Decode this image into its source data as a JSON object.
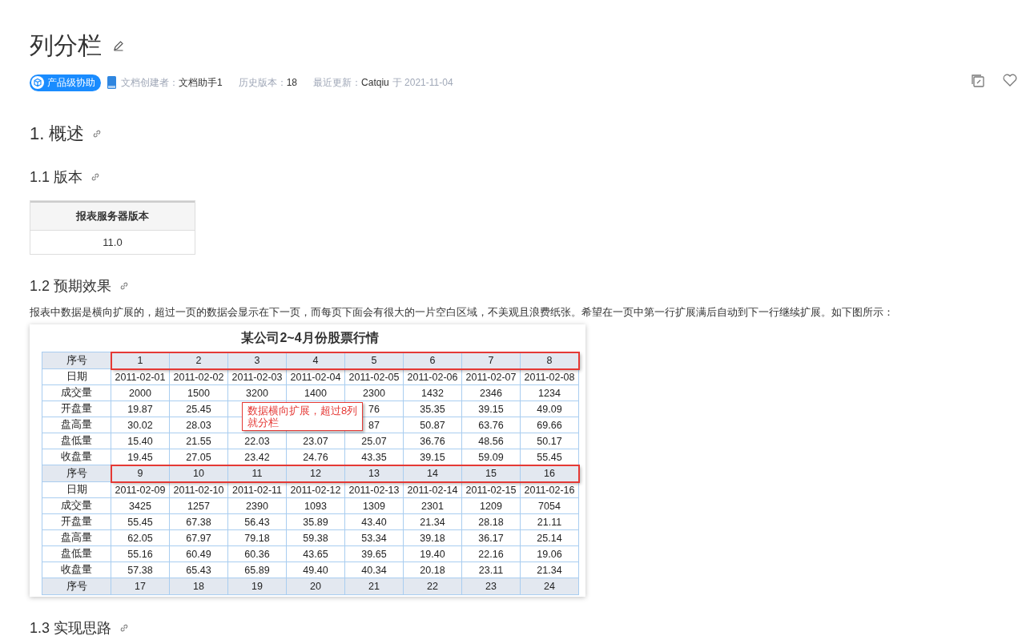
{
  "title": "列分栏",
  "meta": {
    "badge": "产品级协助",
    "creator_label": "文档创建者：",
    "creator": "文档助手1",
    "history_label": "历史版本：",
    "history": "18",
    "updated_label": "最近更新：",
    "updated_by": "Catqiu",
    "updated_at": "于 2021-11-04"
  },
  "sections": [
    {
      "heading": "1. 概述",
      "kind": "major"
    },
    {
      "heading": "1.1 版本",
      "kind": "minor"
    }
  ],
  "version_table": {
    "header": "报表服务器版本",
    "value": "11.0"
  },
  "section_effect": {
    "heading": "1.2 预期效果"
  },
  "paragraph": "报表中数据是横向扩展的，超过一页的数据会显示在下一页，而每页下面会有很大的一片空白区域，不美观且浪费纸张。希望在一页中第一行扩展满后自动到下一行继续扩展。如下图所示：",
  "report": {
    "title": "某公司2~4月份股票行情",
    "blocks": [
      {
        "highlighted": true,
        "rows": [
          {
            "kind": "header",
            "label": "序号",
            "cells": [
              "1",
              "2",
              "3",
              "4",
              "5",
              "6",
              "7",
              "8"
            ]
          },
          {
            "kind": "data",
            "label": "日期",
            "cells": [
              "2011-02-01",
              "2011-02-02",
              "2011-02-03",
              "2011-02-04",
              "2011-02-05",
              "2011-02-06",
              "2011-02-07",
              "2011-02-08"
            ]
          },
          {
            "kind": "data",
            "label": "成交量",
            "cells": [
              "2000",
              "1500",
              "3200",
              "1400",
              "2300",
              "1432",
              "2346",
              "1234"
            ]
          },
          {
            "kind": "data",
            "label": "开盘量",
            "cells": [
              "19.87",
              "25.45",
              null,
              null,
              "76",
              "35.35",
              "39.15",
              "49.09"
            ]
          },
          {
            "kind": "data",
            "label": "盘高量",
            "cells": [
              "30.02",
              "28.03",
              null,
              null,
              "87",
              "50.87",
              "63.76",
              "69.66"
            ]
          },
          {
            "kind": "data",
            "label": "盘低量",
            "cells": [
              "15.40",
              "21.55",
              "22.03",
              "23.07",
              "25.07",
              "36.76",
              "48.56",
              "50.17"
            ]
          },
          {
            "kind": "data",
            "label": "收盘量",
            "cells": [
              "19.45",
              "27.05",
              "23.42",
              "24.76",
              "43.35",
              "39.15",
              "59.09",
              "55.45"
            ]
          }
        ]
      },
      {
        "highlighted": true,
        "rows": [
          {
            "kind": "header",
            "label": "序号",
            "cells": [
              "9",
              "10",
              "11",
              "12",
              "13",
              "14",
              "15",
              "16"
            ]
          },
          {
            "kind": "data",
            "label": "日期",
            "cells": [
              "2011-02-09",
              "2011-02-10",
              "2011-02-11",
              "2011-02-12",
              "2011-02-13",
              "2011-02-14",
              "2011-02-15",
              "2011-02-16"
            ]
          },
          {
            "kind": "data",
            "label": "成交量",
            "cells": [
              "3425",
              "1257",
              "2390",
              "1093",
              "1309",
              "2301",
              "1209",
              "7054"
            ]
          },
          {
            "kind": "data",
            "label": "开盘量",
            "cells": [
              "55.45",
              "67.38",
              "56.43",
              "35.89",
              "43.40",
              "21.34",
              "28.18",
              "21.11"
            ]
          },
          {
            "kind": "data",
            "label": "盘高量",
            "cells": [
              "62.05",
              "67.97",
              "79.18",
              "59.38",
              "53.34",
              "39.18",
              "36.17",
              "25.14"
            ]
          },
          {
            "kind": "data",
            "label": "盘低量",
            "cells": [
              "55.16",
              "60.49",
              "60.36",
              "43.65",
              "39.65",
              "19.40",
              "22.16",
              "19.06"
            ]
          },
          {
            "kind": "data",
            "label": "收盘量",
            "cells": [
              "57.38",
              "65.43",
              "65.89",
              "49.40",
              "40.34",
              "20.18",
              "23.11",
              "21.34"
            ]
          }
        ]
      },
      {
        "highlighted": false,
        "rows": [
          {
            "kind": "header",
            "label": "序号",
            "cells": [
              "17",
              "18",
              "19",
              "20",
              "21",
              "22",
              "23",
              "24"
            ]
          }
        ]
      }
    ],
    "callout": {
      "lines": [
        "数据横向扩展，超过8列",
        "就分栏"
      ]
    }
  },
  "section_next": {
    "heading": "1.3 实现思路"
  }
}
